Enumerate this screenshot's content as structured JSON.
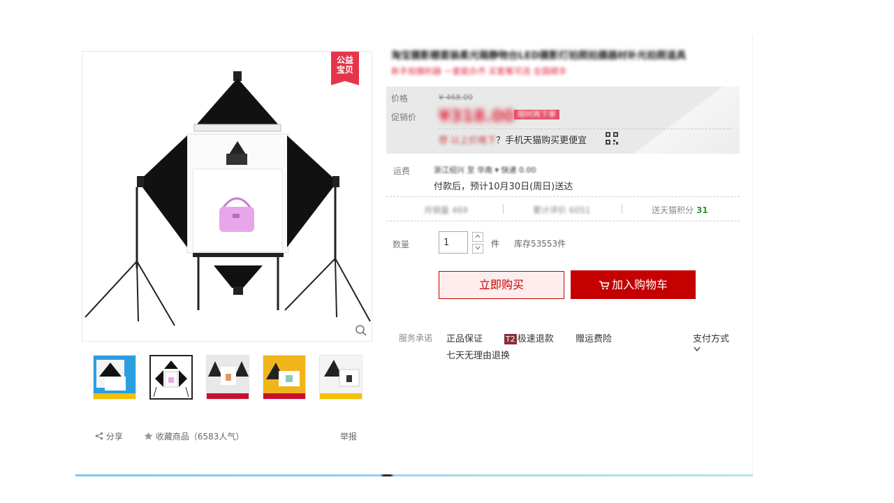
{
  "badge": {
    "line1": "公益",
    "line2": "宝贝"
  },
  "product": {
    "title": "淘宝摄影棚套装柔光箱静物台LED摄影灯拍照拍摄器材补光拍照道具",
    "subtitle": "新手拍摄利器 一套能办齐 买套餐可选 全国顺丰"
  },
  "price": {
    "label": "价格",
    "original": "¥ 468.00",
    "promo_label": "促销价",
    "promo_value": "¥318.00",
    "promo_tag": "限时再下单",
    "mobile_tip_blur": "想 以上价格下",
    "mobile_tip": "？手机天猫购买更便宜"
  },
  "shipping": {
    "label": "运费",
    "line1": "浙江绍兴 至 华南 ▾ 快递 0.00",
    "line2": "付款后，预计10月30日(周日)送达"
  },
  "stats": {
    "monthly_sales": "月销量 469",
    "reviews": "累计评价 6051",
    "points_label": "送天猫积分",
    "points_value": "31"
  },
  "quantity": {
    "label": "数量",
    "value": "1",
    "unit": "件",
    "stock": "库存53553件"
  },
  "actions": {
    "buy_now": "立即购买",
    "add_to_cart": "加入购物车"
  },
  "services": {
    "label": "服务承诺",
    "genuine": "正品保证",
    "t2_badge": "T2",
    "fast_refund": "极速退款",
    "shipping_insurance": "赠运费险",
    "seven_day": "七天无理由退换",
    "payment": "支付方式"
  },
  "footer": {
    "share": "分享",
    "favorite": "收藏商品（6583人气）",
    "report": "举报"
  },
  "colors": {
    "accent": "#c40000",
    "promo": "#e0283c",
    "points": "#2e9a37"
  }
}
